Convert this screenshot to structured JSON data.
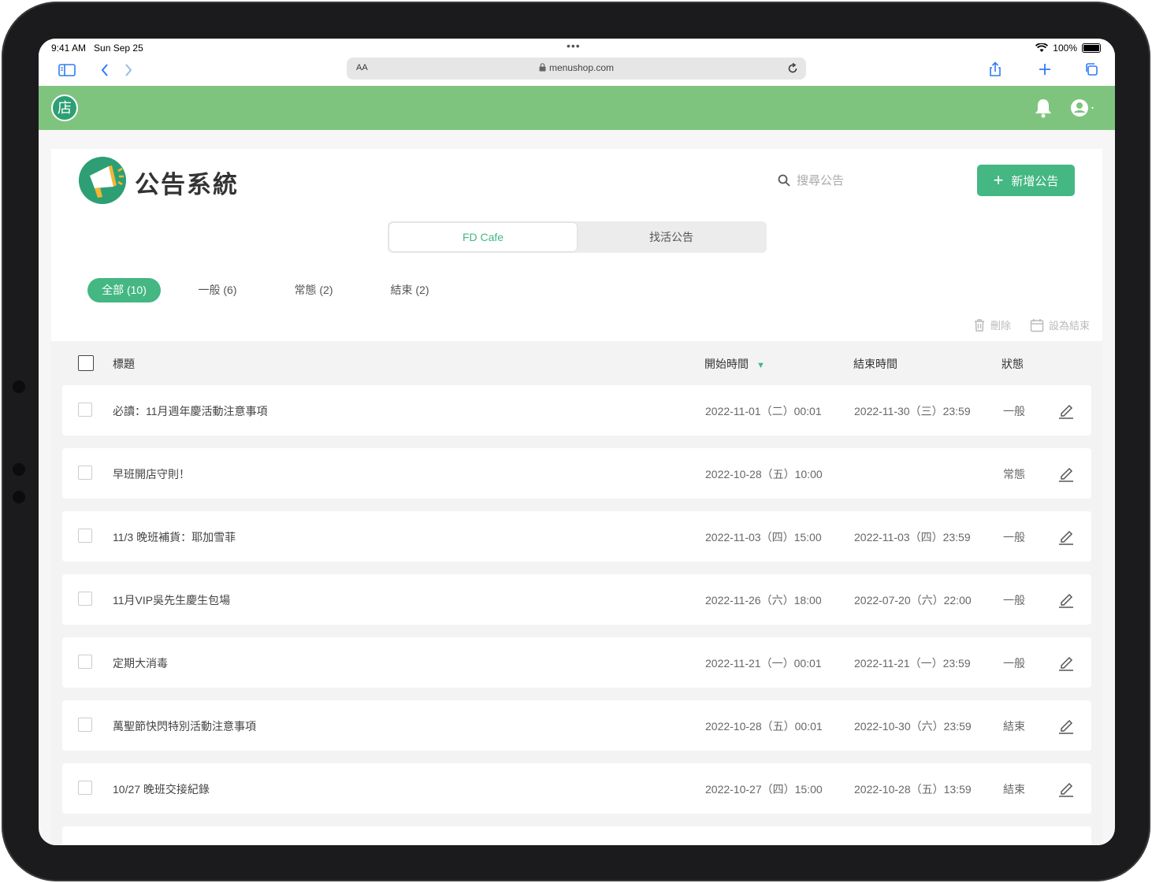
{
  "status_bar": {
    "time_date": "9:41 AM   Sun Sep 25",
    "dots": "•••",
    "battery": "100%"
  },
  "browser": {
    "text_size_label": "AA",
    "url": "menushop.com"
  },
  "app_header": {
    "logo_glyph": "店"
  },
  "page": {
    "title": "公告系統",
    "search_placeholder": "搜尋公告",
    "add_button_label": "新增公告"
  },
  "segments": [
    {
      "label": "FD Cafe",
      "active": true
    },
    {
      "label": "找活公告",
      "active": false
    }
  ],
  "filters": [
    {
      "label": "全部 (10)",
      "active": true
    },
    {
      "label": "一般 (6)",
      "active": false
    },
    {
      "label": "常態 (2)",
      "active": false
    },
    {
      "label": "結束 (2)",
      "active": false
    }
  ],
  "actions": {
    "delete_label": "刪除",
    "set_end_label": "設為結束"
  },
  "table": {
    "columns": {
      "title": "標題",
      "start": "開始時間",
      "end": "結束時間",
      "status": "狀態"
    },
    "rows": [
      {
        "title": "必讀：11月週年慶活動注意事項",
        "start": "2022-11-01（二）00:01",
        "end": "2022-11-30（三）23:59",
        "status": "一般"
      },
      {
        "title": "早班開店守則！",
        "start": "2022-10-28（五）10:00",
        "end": "",
        "status": "常態"
      },
      {
        "title": "11/3 晚班補貨：耶加雪菲",
        "start": "2022-11-03（四）15:00",
        "end": "2022-11-03（四）23:59",
        "status": "一般"
      },
      {
        "title": "11月VIP吳先生慶生包場",
        "start": "2022-11-26（六）18:00",
        "end": "2022-07-20（六）22:00",
        "status": "一般"
      },
      {
        "title": "定期大消毒",
        "start": "2022-11-21（一）00:01",
        "end": "2022-11-21（一）23:59",
        "status": "一般"
      },
      {
        "title": "萬聖節快閃特別活動注意事項",
        "start": "2022-10-28（五）00:01",
        "end": "2022-10-30（六）23:59",
        "status": "結束"
      },
      {
        "title": "10/27 晚班交接紀錄",
        "start": "2022-10-27（四）15:00",
        "end": "2022-10-28（五）13:59",
        "status": "結束"
      }
    ]
  },
  "colors": {
    "header_green": "#7fc47e",
    "accent": "#44b783",
    "brand_dark": "#2e9f74"
  }
}
